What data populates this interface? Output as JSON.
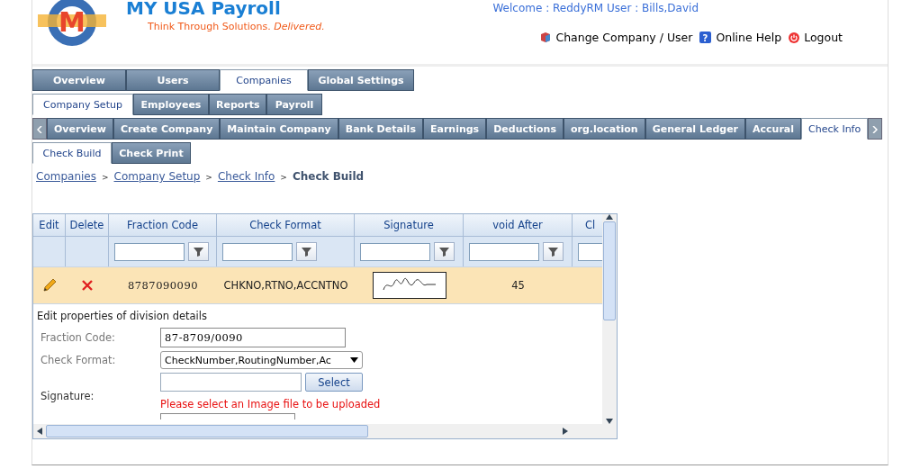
{
  "app": {
    "title": "MY USA Payroll",
    "tagline": "Think Through Solutions.",
    "tagline_emphasis": "Delivered.",
    "logo_letter": "M",
    "welcome": "Welcome : ReddyRM User : Bills,David"
  },
  "header_links": [
    {
      "label": "Change Company / User",
      "kind": "company"
    },
    {
      "label": "Online Help",
      "kind": "help",
      "icon_text": "?"
    },
    {
      "label": "Logout",
      "kind": "logout"
    }
  ],
  "main_tabs": [
    {
      "label": "Overview",
      "selected": false
    },
    {
      "label": "Users",
      "selected": false
    },
    {
      "label": "Companies",
      "selected": true
    },
    {
      "label": "Global Settings",
      "selected": false
    }
  ],
  "sub_tabs": [
    {
      "label": "Company Setup",
      "selected": true
    },
    {
      "label": "Employees",
      "selected": false
    },
    {
      "label": "Reports",
      "selected": false
    },
    {
      "label": "Payroll",
      "selected": false
    }
  ],
  "section_tabs": [
    {
      "label": "Overview",
      "selected": false
    },
    {
      "label": "Create Company",
      "selected": false
    },
    {
      "label": "Maintain Company",
      "selected": false
    },
    {
      "label": "Bank Details",
      "selected": false
    },
    {
      "label": "Earnings",
      "selected": false
    },
    {
      "label": "Deductions",
      "selected": false
    },
    {
      "label": "org.location",
      "selected": false
    },
    {
      "label": "General Ledger",
      "selected": false
    },
    {
      "label": "Accural",
      "selected": false
    },
    {
      "label": "Check Info",
      "selected": true
    }
  ],
  "check_tabs": [
    {
      "label": "Check Build",
      "selected": true
    },
    {
      "label": "Check Print",
      "selected": false
    }
  ],
  "breadcrumb": {
    "links": [
      {
        "label": "Companies",
        "separator": ">"
      },
      {
        "label": "Company Setup",
        "separator": ">"
      },
      {
        "label": "Check Info",
        "separator": ">"
      }
    ],
    "current": "Check Build"
  },
  "grid": {
    "columns": [
      {
        "label": "Edit",
        "filter": false
      },
      {
        "label": "Delete",
        "filter": false
      },
      {
        "label": "Fraction Code",
        "filter": true
      },
      {
        "label": "Check Format",
        "filter": true
      },
      {
        "label": "Signature",
        "filter": true
      },
      {
        "label": "void After",
        "filter": true
      },
      {
        "label": "Cl",
        "filter": true
      }
    ],
    "rows": [
      {
        "fraction_code": "8787090090",
        "check_format": "CHKNO,RTNO,ACCNTNO",
        "void_after": "45",
        "selected": true
      }
    ],
    "edit_form": {
      "title": "Edit properties of division details",
      "fraction_code_label": "Fraction Code:",
      "fraction_code": "87-8709/0090",
      "check_format_label": "Check Format:",
      "check_format": "CheckNumber,RoutingNumber,Ac",
      "signature_label": "Signature:",
      "select_button": "Select",
      "error": "Please select an Image file to be uploaded"
    }
  }
}
